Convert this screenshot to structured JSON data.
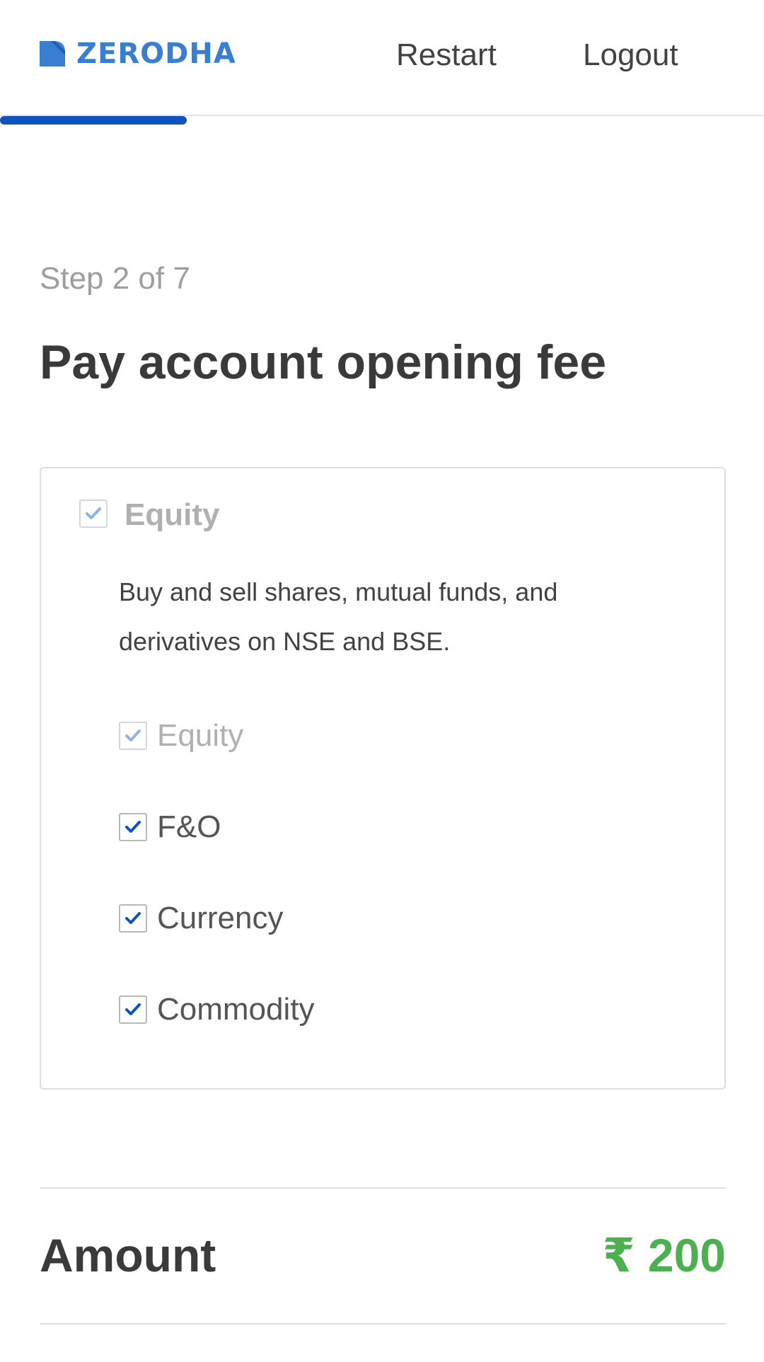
{
  "header": {
    "brand": "ZERODHA",
    "restart_label": "Restart",
    "logout_label": "Logout",
    "progress_fraction": 0.244
  },
  "colors": {
    "brand_blue": "#387ed1",
    "progress_blue": "#0f53bd",
    "check_blue": "#0f53bd",
    "check_disabled": "#8fb4e3",
    "amount_green": "#4caf50"
  },
  "step": {
    "label": "Step 2 of 7",
    "title": "Pay account opening fee"
  },
  "segment": {
    "title": "Equity",
    "description": "Buy and sell shares, mutual funds, and derivatives on NSE and BSE.",
    "header_checked": true,
    "header_disabled": true,
    "options": [
      {
        "label": "Equity",
        "checked": true,
        "disabled": true
      },
      {
        "label": "F&O",
        "checked": true,
        "disabled": false
      },
      {
        "label": "Currency",
        "checked": true,
        "disabled": false
      },
      {
        "label": "Commodity",
        "checked": true,
        "disabled": false
      }
    ]
  },
  "amount": {
    "label": "Amount",
    "value": "₹ 200"
  },
  "icons": {
    "logo": "zerodha-logo-icon",
    "checkmark": "checkmark-icon"
  }
}
